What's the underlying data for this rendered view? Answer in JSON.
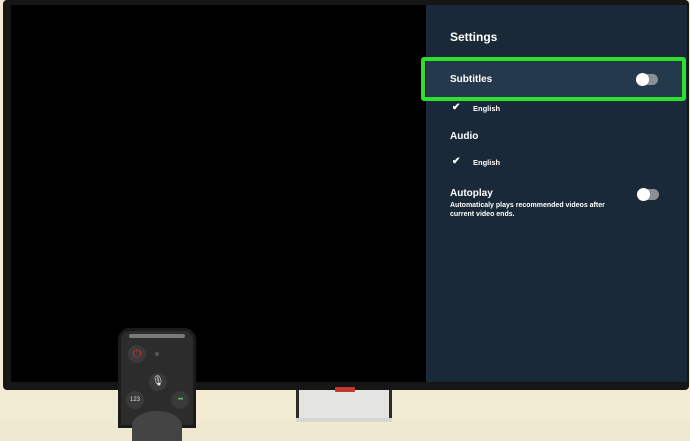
{
  "settings": {
    "title": "Settings",
    "subtitles": {
      "label": "Subtitles",
      "language": "English",
      "enabled": false
    },
    "audio": {
      "label": "Audio",
      "language": "English"
    },
    "autoplay": {
      "label": "Autoplay",
      "description": "Automaticaly plays recommended videos after current video ends.",
      "enabled": false
    },
    "check_icon": "check-icon",
    "highlight_color": "#2ee02e",
    "panel_color": "#1a2938"
  },
  "remote": {
    "btn_123": "123",
    "btn_color": "••••",
    "power_icon": "power-icon",
    "mic_icon": "mic-icon"
  }
}
